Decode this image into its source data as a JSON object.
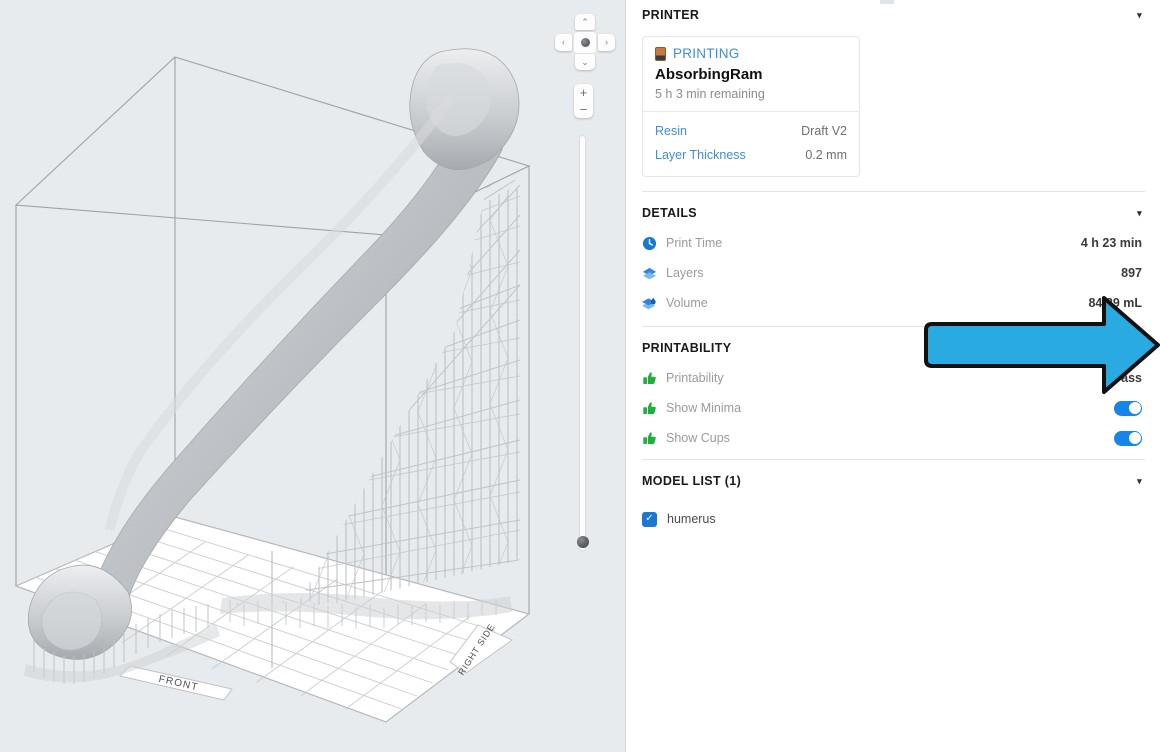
{
  "viewport": {
    "name": "3d-build-viewport",
    "background_color": "#e7ebed",
    "plate_labels": {
      "front": "FRONT",
      "right": "RIGHT SIDE"
    },
    "model_color": "#b9bcc0",
    "nav_gizmo": {
      "up": "⌃",
      "down": "⌄",
      "left": "‹",
      "right": "›"
    },
    "zoom_controls": {
      "zoom_in": "+",
      "zoom_out": "−"
    }
  },
  "panel": {
    "printer": {
      "heading": "PRINTER",
      "caret": "▾",
      "status": "PRINTING",
      "status_color": "#3f8ddb",
      "job_name": "AbsorbingRam",
      "remaining": "5 h 3 min remaining",
      "rows": [
        {
          "key": "Resin",
          "value": "Draft V2"
        },
        {
          "key": "Layer Thickness",
          "value": "0.2 mm"
        }
      ]
    },
    "details": {
      "heading": "DETAILS",
      "caret": "▾",
      "rows": [
        {
          "icon": "clock-icon",
          "label": "Print Time",
          "value": "4 h 23 min"
        },
        {
          "icon": "layers-icon",
          "label": "Layers",
          "value": "897"
        },
        {
          "icon": "volume-icon",
          "label": "Volume",
          "value": "84.29 mL"
        }
      ]
    },
    "printability": {
      "heading": "PRINTABILITY",
      "caret": "▾",
      "master_toggle": true,
      "rows": [
        {
          "icon": "thumbs-up-icon",
          "label": "Printability",
          "value": "Pass",
          "type": "text"
        },
        {
          "icon": "thumbs-up-icon",
          "label": "Show Minima",
          "value": true,
          "type": "toggle"
        },
        {
          "icon": "thumbs-up-icon",
          "label": "Show Cups",
          "value": true,
          "type": "toggle"
        }
      ]
    },
    "model_list": {
      "heading": "MODEL LIST (1)",
      "caret": "▾",
      "items": [
        {
          "name": "humerus",
          "checked": true,
          "check_glyph": "✓"
        }
      ]
    }
  },
  "annotation": {
    "arrow": {
      "name": "blue-right-arrow",
      "fill": "#29ABE2",
      "stroke": "#000000",
      "direction": "right"
    }
  }
}
